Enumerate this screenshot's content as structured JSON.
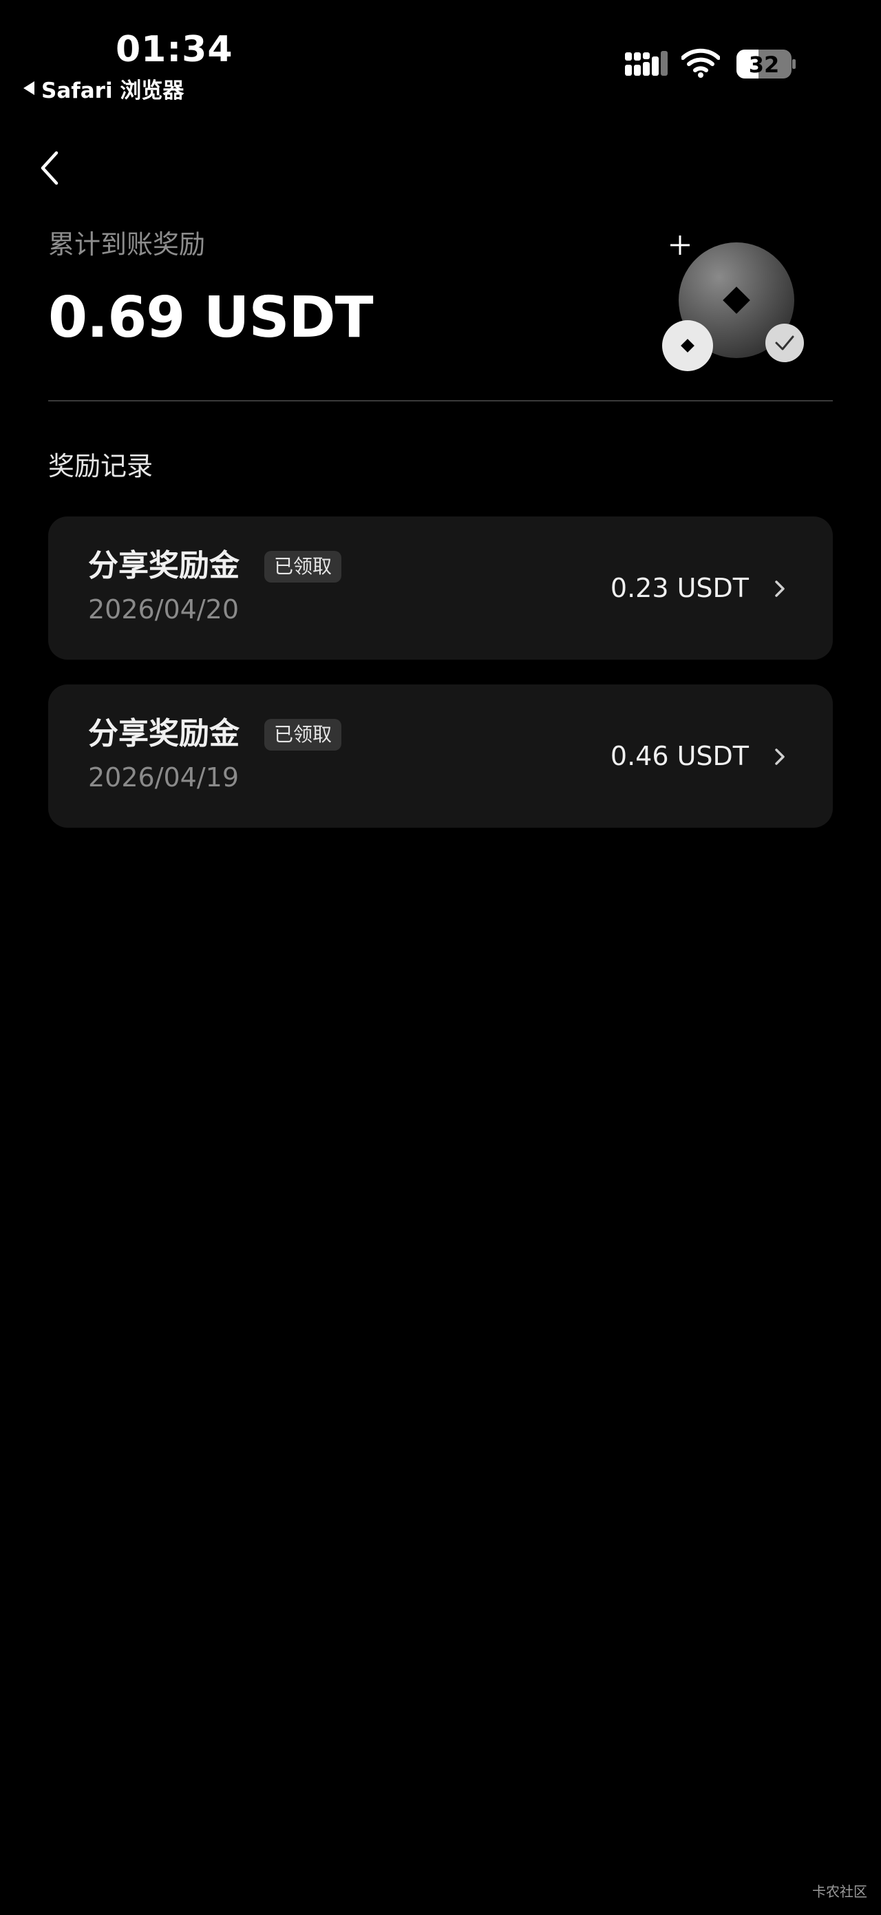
{
  "status_bar": {
    "time": "01:34",
    "back_app": "Safari 浏览器",
    "battery": "32"
  },
  "header": {
    "label": "累计到账奖励",
    "total": "0.69 USDT"
  },
  "records": {
    "title": "奖励记录",
    "items": [
      {
        "title": "分享奖励金",
        "badge": "已领取",
        "date": "2026/04/20",
        "amount": "0.23 USDT"
      },
      {
        "title": "分享奖励金",
        "badge": "已领取",
        "date": "2026/04/19",
        "amount": "0.46 USDT"
      }
    ]
  },
  "watermark": "卡农社区",
  "icons": {
    "back": "chevron-left-icon",
    "row": "chevron-right-icon"
  }
}
